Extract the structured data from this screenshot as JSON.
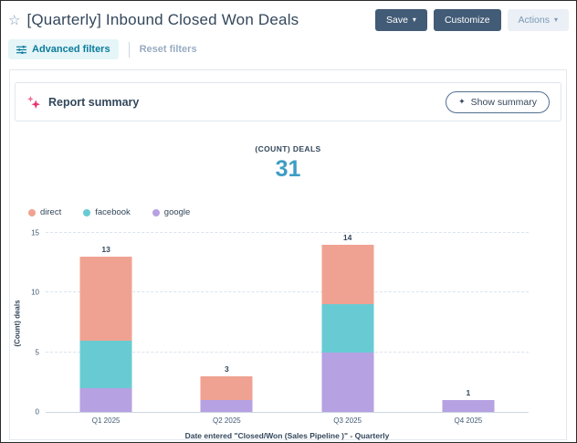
{
  "header": {
    "star_icon": "☆",
    "title": "[Quarterly] Inbound Closed Won Deals",
    "save_label": "Save",
    "customize_label": "Customize",
    "actions_label": "Actions",
    "caret": "▾"
  },
  "filter_bar": {
    "advanced_filters_label": "Advanced filters",
    "reset_filters_label": "Reset filters"
  },
  "report_summary": {
    "title": "Report summary",
    "show_summary_icon": "✦",
    "show_summary_label": "Show summary"
  },
  "kpi": {
    "label": "(COUNT) DEALS",
    "value": "31"
  },
  "colors": {
    "text_navy": "#33475b",
    "button_dark": "#425b76",
    "kpi_value_blue": "#3e9dc4",
    "advanced_filter_teal": "#0b7c9b",
    "sparkle_pink": "#e8366d"
  },
  "chart_data": {
    "type": "bar",
    "stacked": true,
    "categories": [
      "Q1 2025",
      "Q2 2025",
      "Q3 2025",
      "Q4 2025"
    ],
    "series": [
      {
        "name": "direct",
        "color": "#f0a292",
        "values": [
          7,
          2,
          5,
          0
        ]
      },
      {
        "name": "facebook",
        "color": "#68cbd3",
        "values": [
          4,
          0,
          4,
          0
        ]
      },
      {
        "name": "google",
        "color": "#b6a1e2",
        "values": [
          2,
          1,
          5,
          1
        ]
      }
    ],
    "stack_order_bottom_to_top": [
      "google",
      "facebook",
      "direct"
    ],
    "totals": [
      13,
      3,
      14,
      1
    ],
    "title": "",
    "xlabel": "Date entered \"Closed/Won (Sales Pipeline )\" - Quarterly",
    "ylabel": "(Count) deals",
    "ylim": [
      0,
      15
    ],
    "yticks": [
      0,
      5,
      10,
      15
    ],
    "grid": "dashed-horizontal",
    "legend_position": "top-left"
  }
}
